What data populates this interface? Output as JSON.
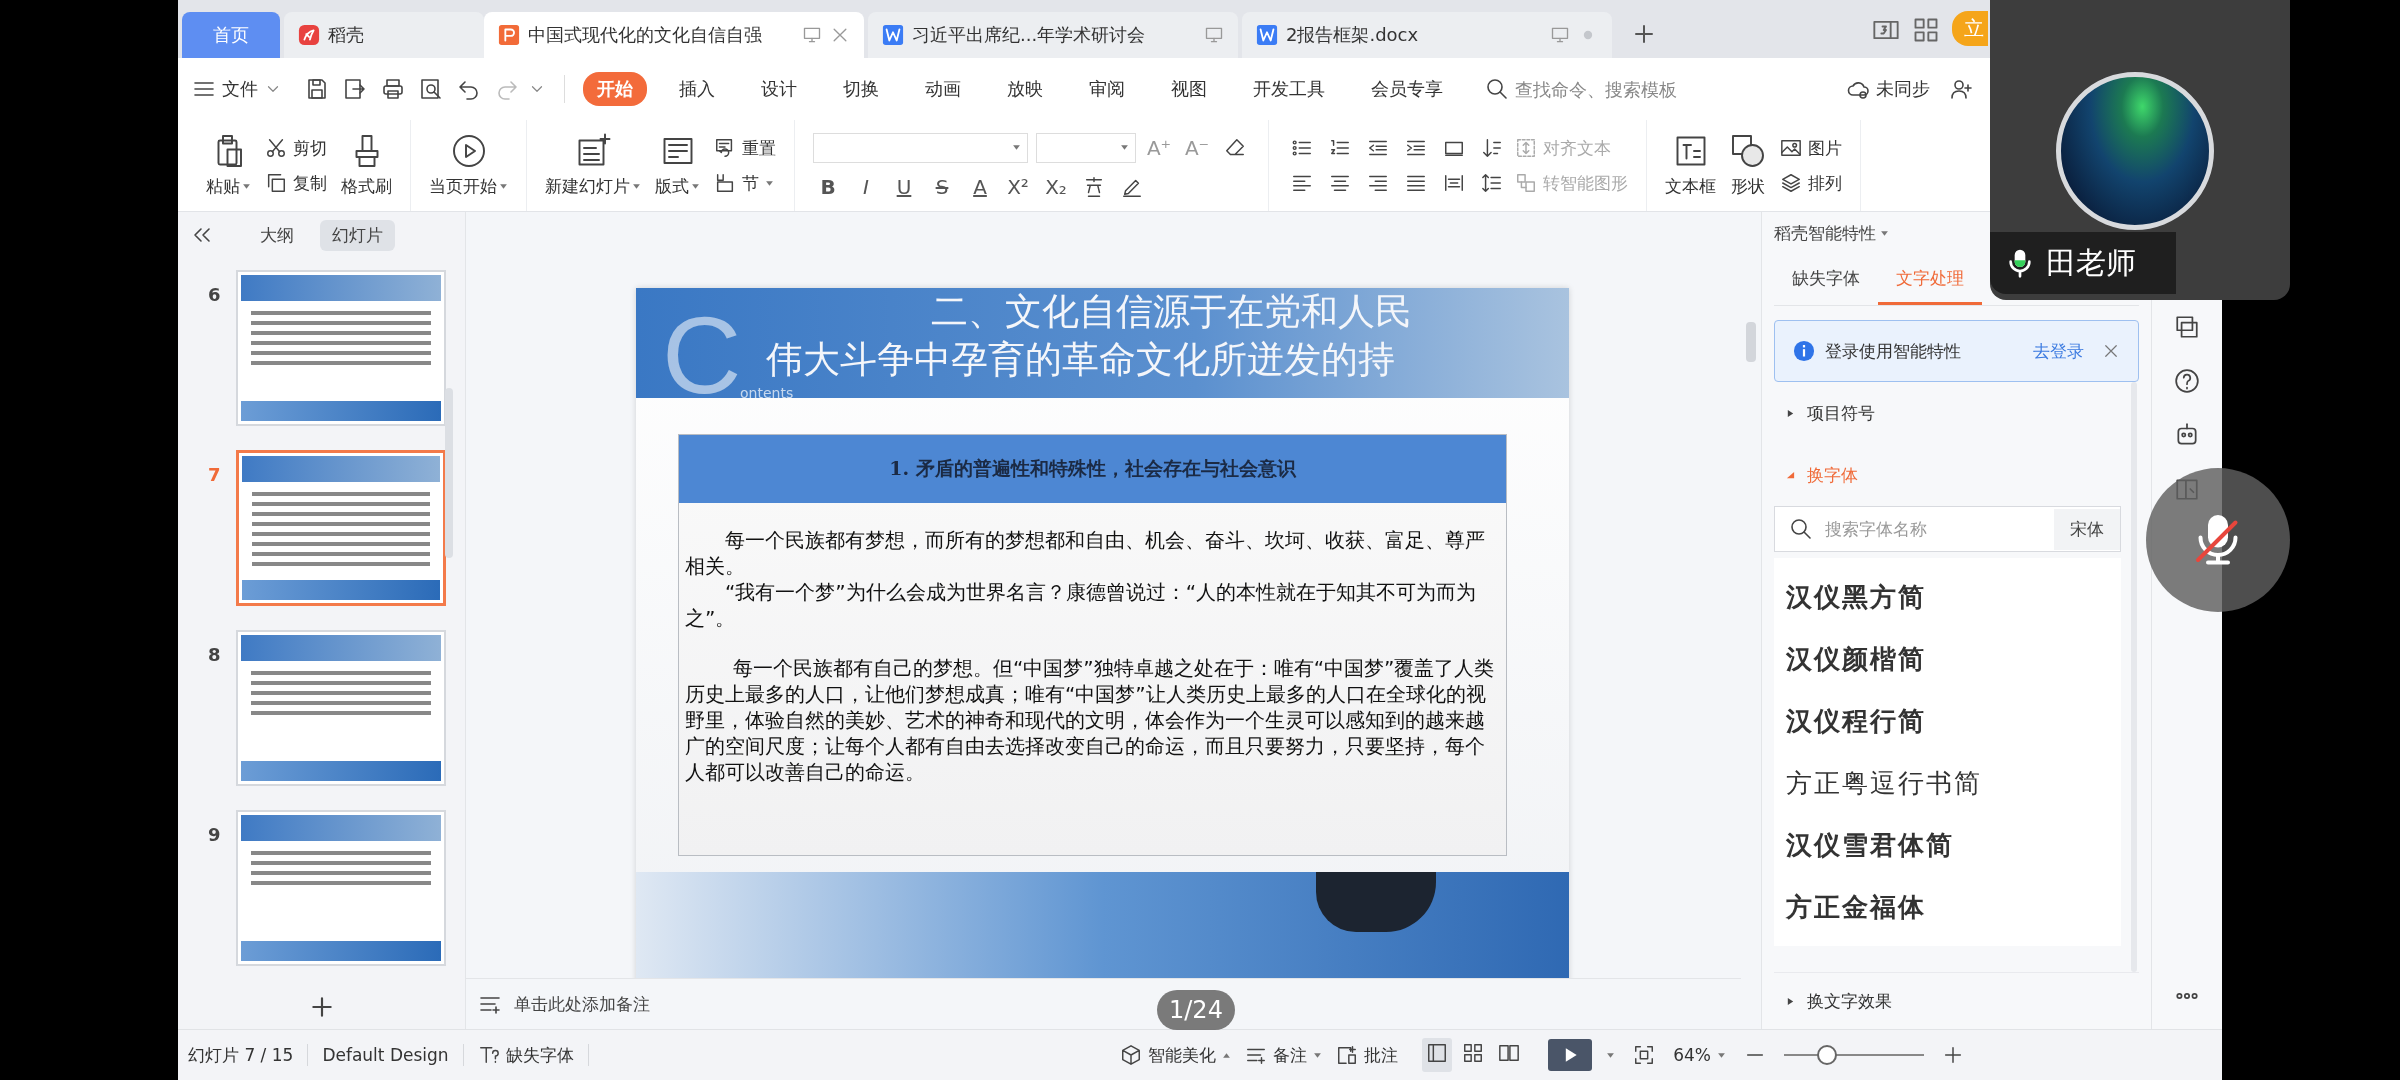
{
  "tab_bar": {
    "tabs": [
      {
        "label": "首页",
        "kind": "home",
        "selected": false
      },
      {
        "label": "稻壳",
        "kind": "docer",
        "selected": false
      },
      {
        "label": "中国式现代化的文化自信自强",
        "kind": "presentation",
        "selected": true
      },
      {
        "label": "习近平出席纪...年学术研讨会",
        "kind": "document",
        "selected": false
      },
      {
        "label": "2报告框架.docx",
        "kind": "document",
        "selected": false
      }
    ],
    "upgrade_badge": "立"
  },
  "menu_bar": {
    "file_menu": "文件",
    "tabs": [
      {
        "label": "开始",
        "selected": true
      },
      {
        "label": "插入",
        "selected": false
      },
      {
        "label": "设计",
        "selected": false
      },
      {
        "label": "切换",
        "selected": false
      },
      {
        "label": "动画",
        "selected": false
      },
      {
        "label": "放映",
        "selected": false
      },
      {
        "label": "审阅",
        "selected": false
      },
      {
        "label": "视图",
        "selected": false
      },
      {
        "label": "开发工具",
        "selected": false
      },
      {
        "label": "会员专享",
        "selected": false
      }
    ],
    "search": {
      "placeholder": "查找命令、搜索模板"
    },
    "sync_status": "未同步"
  },
  "ribbon": {
    "paste": "粘贴",
    "cut": "剪切",
    "copy": "复制",
    "format_painter": "格式刷",
    "play_from_current": "当页开始",
    "new_slide": "新建幻灯片",
    "layout": "版式",
    "reset": "重置",
    "section": "节",
    "size_buttons": [
      "A⁺",
      "A⁻"
    ],
    "format_buttons": [
      "B",
      "I",
      "U",
      "S",
      "A",
      "X²",
      "X₂"
    ],
    "align_text": {
      "label": "对齐文本",
      "disabled": true
    },
    "smart_art": {
      "label": "转智能图形",
      "disabled": true
    },
    "text_box": "文本框",
    "shapes": "形状",
    "picture": "图片",
    "arrange": "排列"
  },
  "slides_panel": {
    "tabs": [
      {
        "label": "大纲",
        "selected": false
      },
      {
        "label": "幻灯片",
        "selected": true
      }
    ],
    "slides": [
      {
        "number": "6",
        "selected": false
      },
      {
        "number": "7",
        "selected": true
      },
      {
        "number": "8",
        "selected": false
      },
      {
        "number": "9",
        "selected": false
      }
    ]
  },
  "slide": {
    "logo_letter": "C",
    "logo_text": "ontents",
    "title_lines": [
      "二、文化自信源于在党和人民",
      "伟大斗争中孕育的革命文化所迸发的持"
    ],
    "box_title": "1. 矛盾的普遍性和特殊性，社会存在与社会意识",
    "paragraphs": [
      "每一个民族都有梦想，而所有的梦想都和自由、机会、奋斗、坎坷、收获、富足、尊严相关。",
      "“我有一个梦”为什么会成为世界名言？康德曾说过：“人的本性就在于知其不可为而为之”。",
      "每一个民族都有自己的梦想。但“中国梦”独特卓越之处在于：唯有“中国梦”覆盖了人类历史上最多的人口，让他们梦想成真；唯有“中国梦”让人类历史上最多的人口在全球化的视野里，体验自然的美妙、艺术的神奇和现代的文明，体会作为一个生灵可以感知到的越来越广的空间尺度；让每个人都有自由去选择改变自己的命运，而且只要努力，只要坚持，每个人都可以改善自己的命运。"
    ]
  },
  "notes": {
    "placeholder": "单击此处添加备注"
  },
  "side_panel": {
    "title": "稻壳智能特性",
    "tabs": [
      {
        "label": "缺失字体",
        "selected": false
      },
      {
        "label": "文字处理",
        "selected": true
      }
    ],
    "banner": {
      "text": "登录使用智能特性",
      "link": "去登录"
    },
    "sections": [
      {
        "label": "项目符号",
        "expanded": false
      },
      {
        "label": "换字体",
        "expanded": true
      },
      {
        "label": "换文字效果",
        "expanded": false
      }
    ],
    "font_search": {
      "placeholder": "搜索字体名称",
      "current": "宋体"
    },
    "fonts": [
      "汉仪黑方简",
      "汉仪颜楷简",
      "汉仪程行简",
      "方正粤逗行书简",
      "汉仪雪君体简",
      "方正金福体"
    ]
  },
  "status_bar": {
    "slide_counter": "幻灯片 7 / 15",
    "theme": "Default Design",
    "missing_fonts": "缺失字体",
    "beautify": "智能美化",
    "notes": "备注",
    "comments": "批注",
    "view_modes": [
      {
        "selected": true
      },
      {
        "selected": false
      },
      {
        "selected": false
      }
    ],
    "zoom": "64%",
    "zoom_slider": {
      "level": 0.3
    }
  },
  "video_call": {
    "speaker": "田老师",
    "page_indicator": "1/24"
  }
}
